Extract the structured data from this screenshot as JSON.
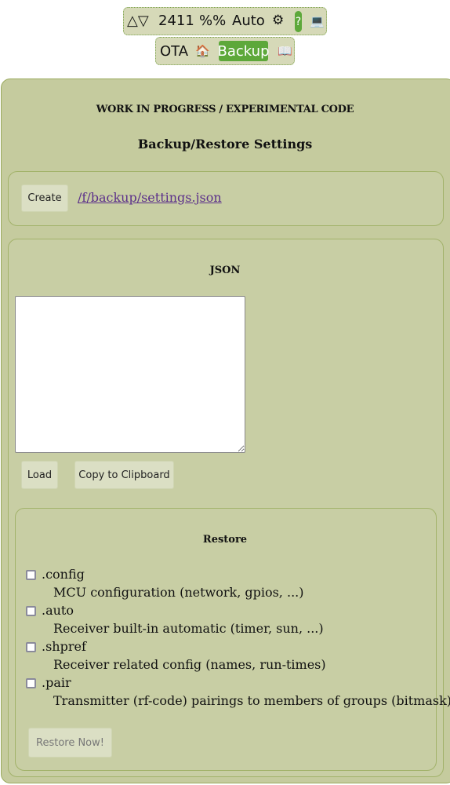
{
  "topbar": {
    "arrows": "△▽",
    "counter": "2411",
    "percent": "%%",
    "auto": "Auto",
    "settings_icon": "⚙",
    "help": "?",
    "computer_icon": "💻"
  },
  "navbar": {
    "ota": "OTA",
    "home_icon": "🏠",
    "active": "Backup",
    "book_icon": "📖"
  },
  "header": {
    "notice": "WORK IN PROGRESS / EXPERIMENTAL CODE",
    "title": "Backup/Restore Settings"
  },
  "create_section": {
    "button": "Create",
    "link": "/f/backup/settings.json"
  },
  "json_section": {
    "heading": "JSON",
    "textarea_value": "",
    "load_button": "Load",
    "copy_button": "Copy to Clipboard"
  },
  "restore_section": {
    "heading": "Restore",
    "options": [
      {
        "name": ".config",
        "desc": "MCU configuration (network, gpios, ...)",
        "checked": false
      },
      {
        "name": ".auto",
        "desc": "Receiver built-in automatic (timer, sun, ...)",
        "checked": false
      },
      {
        "name": ".shpref",
        "desc": "Receiver related config (names, run-times)",
        "checked": false
      },
      {
        "name": ".pair",
        "desc": "Transmitter (rf-code) pairings to members of groups (bitmask)",
        "checked": false
      }
    ],
    "restore_button": "Restore Now!"
  }
}
